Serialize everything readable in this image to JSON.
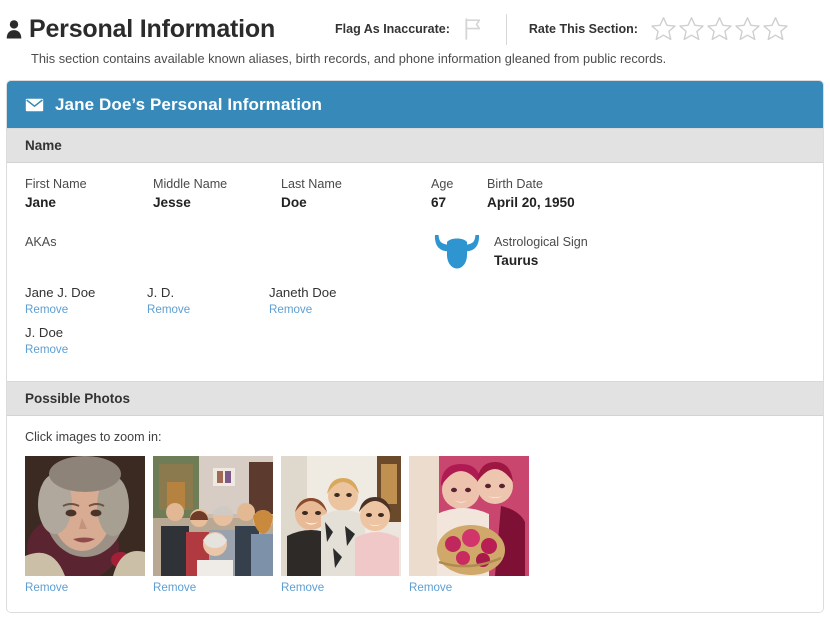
{
  "header": {
    "title": "Personal Information",
    "person_icon": "person-icon",
    "flag_label": "Flag As Inaccurate:",
    "flag_icon": "flag-icon",
    "rate_label": "Rate This Section:",
    "star_icon": "star-outline-icon",
    "star_count": 5,
    "stars_filled": 0,
    "description": "This section contains available known aliases, birth records, and phone information gleaned from public records."
  },
  "card": {
    "header_icon": "envelope-icon",
    "header_title": "Jane Doe’s Personal Information",
    "accent_color": "#3789b9"
  },
  "name_section": {
    "heading": "Name",
    "fields": [
      {
        "label": "First Name",
        "value": "Jane"
      },
      {
        "label": "Middle Name",
        "value": "Jesse"
      },
      {
        "label": "Last Name",
        "value": "Doe"
      },
      {
        "label": "Age",
        "value": "67"
      },
      {
        "label": "Birth Date",
        "value": "April 20, 1950"
      }
    ],
    "akas_label": "AKAs",
    "sign": {
      "icon": "taurus-bull-icon",
      "icon_color": "#2e95d0",
      "label": "Astrological Sign",
      "value": "Taurus"
    },
    "akas": [
      {
        "name": "Jane J. Doe",
        "remove_label": "Remove"
      },
      {
        "name": "J. D.",
        "remove_label": "Remove"
      },
      {
        "name": "Janeth Doe",
        "remove_label": "Remove"
      },
      {
        "name": "J. Doe",
        "remove_label": "Remove"
      }
    ]
  },
  "photos_section": {
    "heading": "Possible Photos",
    "hint": "Click images to zoom in:",
    "photos": [
      {
        "alt": "portrait of older woman with grey hair and floral top",
        "remove_label": "Remove"
      },
      {
        "alt": "group of people at indoor family gathering",
        "remove_label": "Remove"
      },
      {
        "alt": "three women posing together indoors",
        "remove_label": "Remove"
      },
      {
        "alt": "vintage pink-toned photo of couple with flower bouquet",
        "remove_label": "Remove"
      }
    ]
  },
  "link_color": "#5e9ed1"
}
